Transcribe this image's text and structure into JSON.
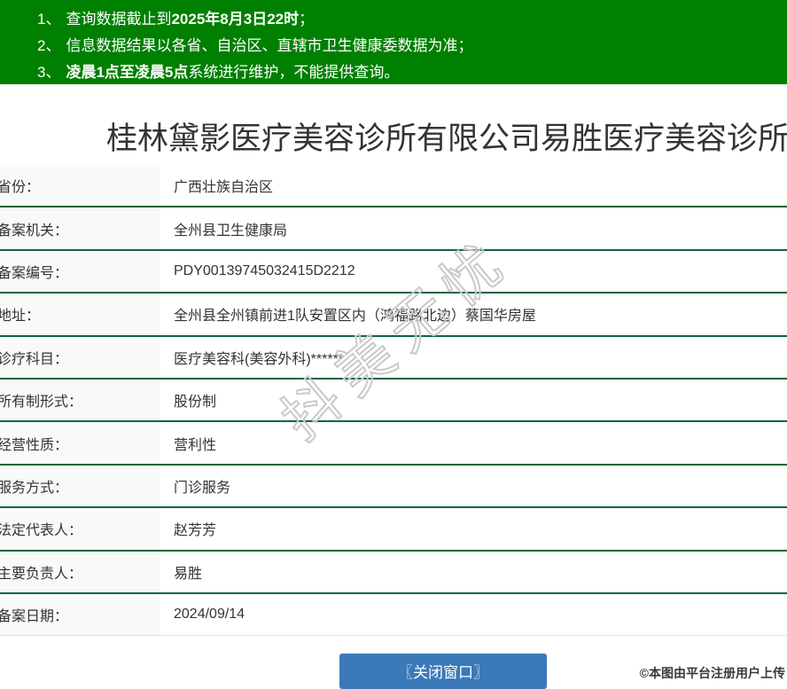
{
  "notice": {
    "items": [
      {
        "num": "1、",
        "pre": "查询数据截止到",
        "bold": "2025年8月3日22时",
        "post": "；"
      },
      {
        "num": "2、",
        "pre": "信息数据结果以各省、自治区、直辖市卫生健康委数据为准；",
        "bold": "",
        "post": ""
      },
      {
        "num": "3、",
        "pre": "",
        "bold": "凌晨1点至凌晨5点",
        "post": "系统进行维护，不能提供查询。"
      }
    ]
  },
  "title": "桂林黛影医疗美容诊所有限公司易胜医疗美容诊所",
  "table": {
    "rows": [
      {
        "label": "省份：",
        "value": "广西壮族自治区"
      },
      {
        "label": "备案机关：",
        "value": "全州县卫生健康局"
      },
      {
        "label": "备案编号：",
        "value": "PDY00139745032415D2212"
      },
      {
        "label": "地址：",
        "value": "全州县全州镇前进1队安置区内（鸿福路北边）蔡国华房屋"
      },
      {
        "label": "诊疗科目：",
        "value": "医疗美容科(美容外科)******"
      },
      {
        "label": "所有制形式：",
        "value": "股份制"
      },
      {
        "label": "经营性质：",
        "value": "营利性"
      },
      {
        "label": "服务方式：",
        "value": "门诊服务"
      },
      {
        "label": "法定代表人：",
        "value": "赵芳芳"
      },
      {
        "label": "主要负责人：",
        "value": "易胜"
      },
      {
        "label": "备案日期：",
        "value": "2024/09/14"
      }
    ]
  },
  "watermark": "抖美无忧",
  "close_button": {
    "label": "〖关闭窗口〗"
  },
  "footer": {
    "stamp": "©本图由平台注册用户上传"
  },
  "colors": {
    "header_green": "#008000",
    "divider_green": "#0e653e",
    "label_bg": "#f9f9f9",
    "button_blue": "#3a7ab8",
    "watermark_gray": "#c9c9c9"
  }
}
